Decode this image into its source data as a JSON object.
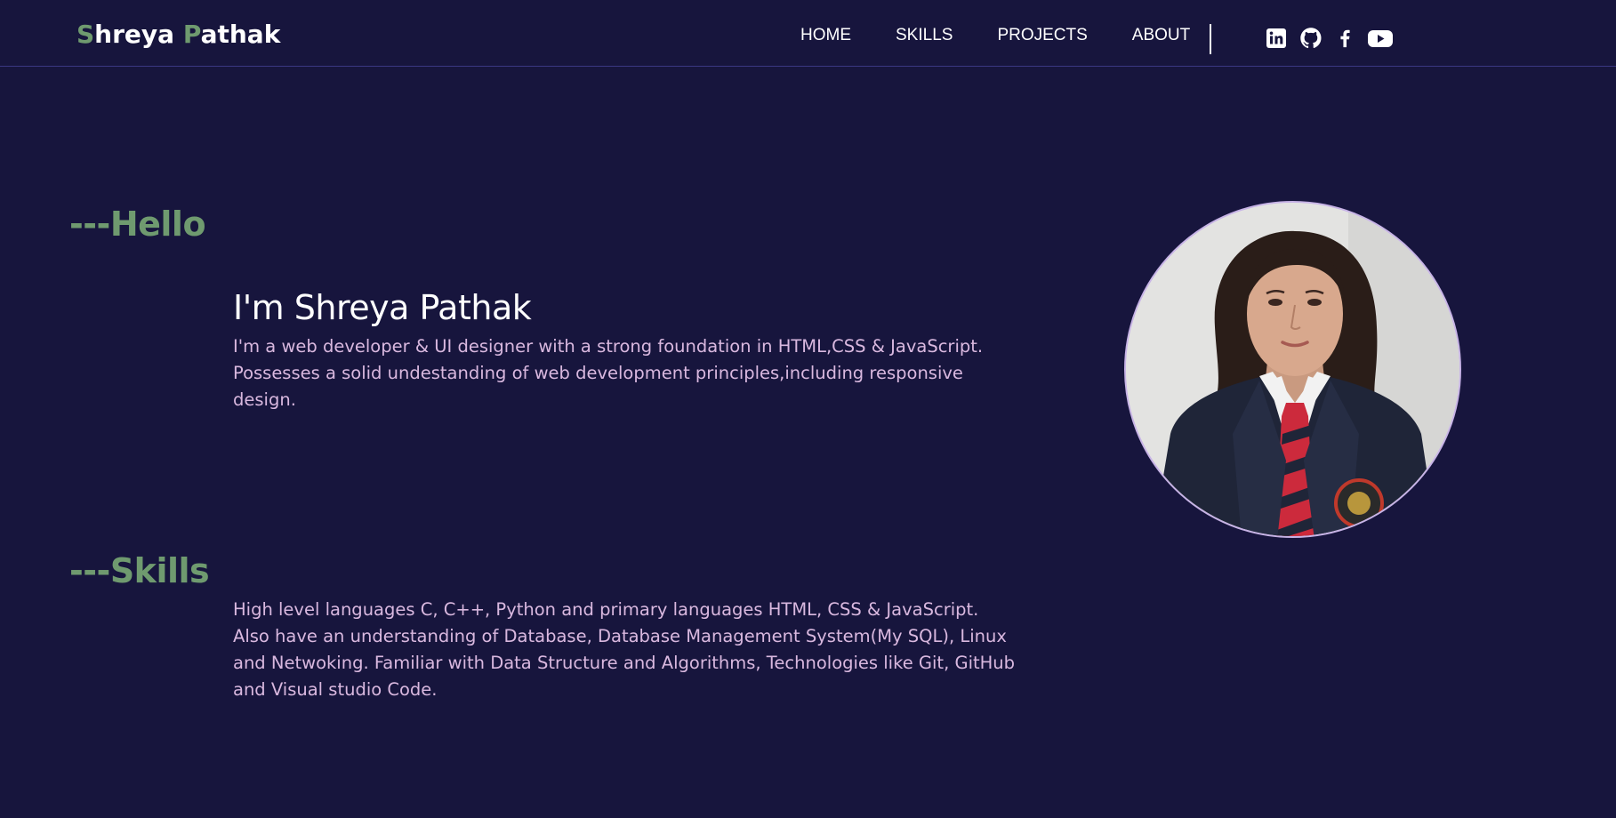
{
  "header": {
    "logo_first_initial": "S",
    "logo_first_rest": "hreya ",
    "logo_last_initial": "P",
    "logo_last_rest": "athak",
    "nav": [
      {
        "label": "HOME"
      },
      {
        "label": "SKILLS"
      },
      {
        "label": "PROJECTS"
      },
      {
        "label": "ABOUT"
      }
    ],
    "social_icons": [
      "linkedin-icon",
      "github-icon",
      "facebook-icon",
      "youtube-icon"
    ]
  },
  "hero": {
    "heading": "---Hello",
    "name": "I'm Shreya Pathak",
    "description": "I'm a web developer & UI designer with a strong foundation in HTML,CSS & JavaScript. Possesses a solid undestanding of web development principles,including responsive design."
  },
  "skills": {
    "heading": "---Skills",
    "description": "High level languages C, C++, Python and primary languages HTML, CSS & JavaScript. Also have an understanding of Database, Database Management System(My SQL), Linux and Netwoking. Familiar with Data Structure and Algorithms, Technologies like Git, GitHub and Visual studio Code."
  },
  "colors": {
    "background": "#17153d",
    "accent_green": "#6f9a6f",
    "text_pink": "#d9b8df",
    "text_white": "#ffffff",
    "photo_border": "#c7b3e6"
  }
}
